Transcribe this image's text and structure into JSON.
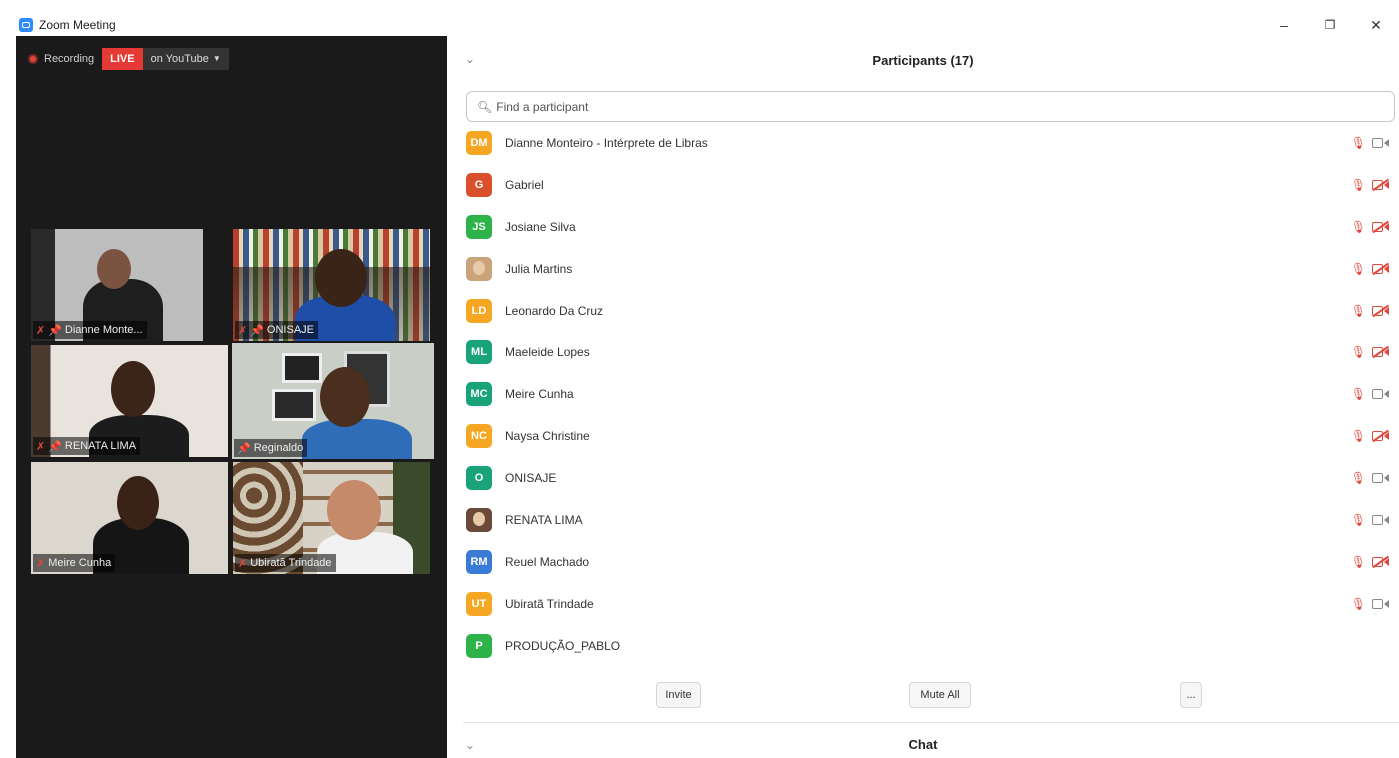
{
  "window": {
    "title": "Zoom Meeting",
    "controls": {
      "minimize": "–",
      "restore": "❐",
      "close": "✕"
    }
  },
  "recording": {
    "recording_label": "Recording",
    "live_label": "LIVE",
    "destination_label": "on YouTube"
  },
  "video_tiles": [
    {
      "name": "Dianne Monte...",
      "muted": true,
      "pinned": true,
      "active": false
    },
    {
      "name": "ONISAJE",
      "muted": true,
      "pinned": true,
      "active": false
    },
    {
      "name": "RENATA LIMA",
      "muted": true,
      "pinned": true,
      "active": false
    },
    {
      "name": "Reginaldo",
      "muted": false,
      "pinned": true,
      "active": true
    },
    {
      "name": "Meire Cunha",
      "muted": true,
      "pinned": false,
      "active": false
    },
    {
      "name": "Ubiratã Trindade",
      "muted": true,
      "pinned": false,
      "active": false
    }
  ],
  "participants_panel": {
    "title": "Participants (17)",
    "search_placeholder": "Find a participant",
    "participants": [
      {
        "initials": "DM",
        "name": "Dianne Monteiro - Intérprete de Libras",
        "color": "#f5a623",
        "mic_muted": true,
        "video_off": false,
        "photo": false
      },
      {
        "initials": "G",
        "name": "Gabriel",
        "color": "#d9502b",
        "mic_muted": true,
        "video_off": true,
        "photo": false
      },
      {
        "initials": "JS",
        "name": "Josiane Silva",
        "color": "#2db34a",
        "mic_muted": true,
        "video_off": true,
        "photo": false
      },
      {
        "initials": "",
        "name": "Julia Martins",
        "color": "#c9a37a",
        "mic_muted": true,
        "video_off": true,
        "photo": true
      },
      {
        "initials": "LD",
        "name": "Leonardo Da Cruz",
        "color": "#f5a623",
        "mic_muted": true,
        "video_off": true,
        "photo": false
      },
      {
        "initials": "ML",
        "name": "Maeleide Lopes",
        "color": "#1aa37a",
        "mic_muted": true,
        "video_off": true,
        "photo": false
      },
      {
        "initials": "MC",
        "name": "Meire Cunha",
        "color": "#1aa37a",
        "mic_muted": true,
        "video_off": false,
        "photo": false
      },
      {
        "initials": "NC",
        "name": "Naysa Christine",
        "color": "#f5a623",
        "mic_muted": true,
        "video_off": true,
        "photo": false
      },
      {
        "initials": "O",
        "name": "ONISAJE",
        "color": "#1aa37a",
        "mic_muted": true,
        "video_off": false,
        "photo": false
      },
      {
        "initials": "",
        "name": "RENATA LIMA",
        "color": "#6b4a3a",
        "mic_muted": true,
        "video_off": false,
        "photo": true
      },
      {
        "initials": "RM",
        "name": "Reuel Machado",
        "color": "#3a7bd5",
        "mic_muted": true,
        "video_off": true,
        "photo": false
      },
      {
        "initials": "UT",
        "name": "Ubiratã Trindade",
        "color": "#f5a623",
        "mic_muted": true,
        "video_off": false,
        "photo": false
      },
      {
        "initials": "P",
        "name": "PRODUÇÃO_PABLO",
        "color": "#2db34a",
        "mic_muted": false,
        "video_off": false,
        "photo": false,
        "no_icons": true
      }
    ],
    "buttons": {
      "invite": "Invite",
      "mute_all": "Mute All",
      "more": "..."
    }
  },
  "chat_panel": {
    "title": "Chat"
  },
  "icons": {
    "mic_muted": "mic-muted-icon",
    "camera": "camera-icon",
    "camera_off": "camera-off-icon",
    "pin": "pin-icon",
    "search": "search-icon"
  }
}
